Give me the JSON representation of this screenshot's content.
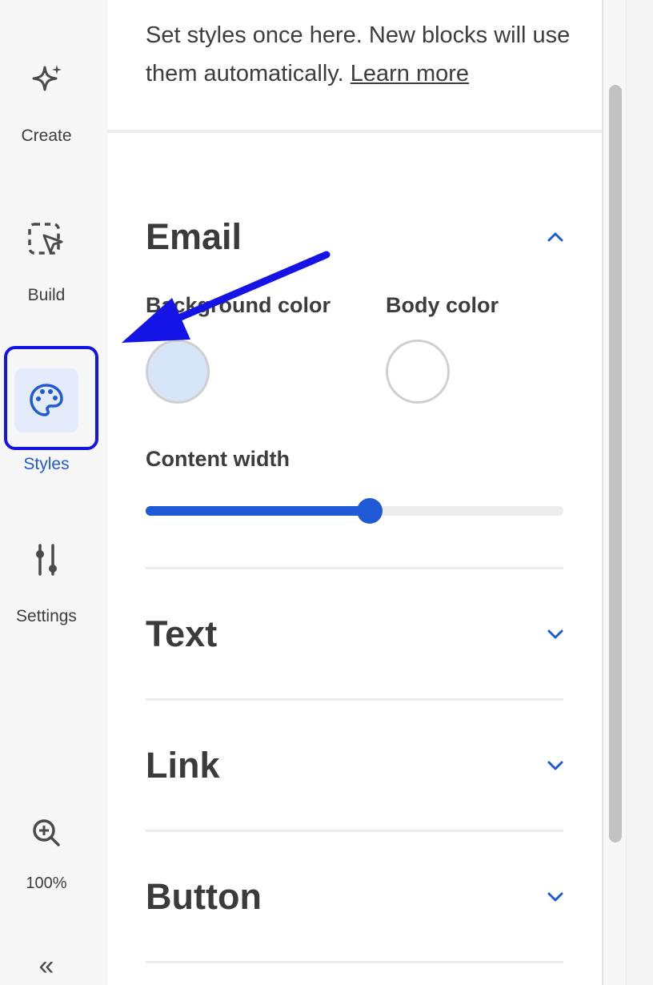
{
  "sidebar": {
    "items": [
      {
        "label": "Create",
        "icon": "sparkle-icon"
      },
      {
        "label": "Build",
        "icon": "select-cursor-icon"
      },
      {
        "label": "Styles",
        "icon": "palette-icon",
        "active": true
      },
      {
        "label": "Settings",
        "icon": "sliders-icon"
      }
    ],
    "zoom": {
      "icon": "zoom-in-icon",
      "label": "100%"
    },
    "collapse_label": "«"
  },
  "panel": {
    "intro_text": "Set styles once here. New blocks will use them automatically.",
    "learn_more": "Learn more",
    "sections": {
      "email": {
        "title": "Email",
        "expanded": true,
        "background_color_label": "Background color",
        "background_color": "#d6e6f7",
        "body_color_label": "Body color",
        "body_color": "#ffffff",
        "content_width_label": "Content width",
        "content_width_fraction": 0.537
      },
      "text": {
        "title": "Text",
        "expanded": false
      },
      "link": {
        "title": "Link",
        "expanded": false
      },
      "button": {
        "title": "Button",
        "expanded": false
      }
    }
  },
  "colors": {
    "accent": "#1f5ad6",
    "annotation": "#1414e6",
    "active_bg": "#e4ecfb"
  }
}
